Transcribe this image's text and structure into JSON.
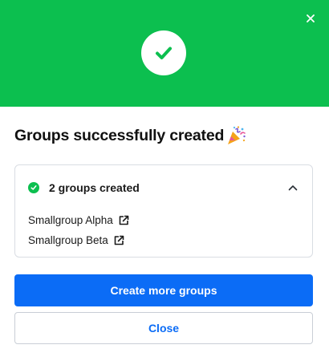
{
  "colors": {
    "banner": "#0cbf4f",
    "primary": "#0b6cf6",
    "border": "#d9dde3"
  },
  "icons": {
    "close": "close-icon",
    "success": "checkmark-icon",
    "celebration": "party-popper-icon",
    "collapse": "chevron-up-icon",
    "external": "external-link-icon"
  },
  "dialog": {
    "title": "Groups successfully created"
  },
  "summary": {
    "count_label": "2 groups created",
    "groups": [
      {
        "name": "Smallgroup Alpha"
      },
      {
        "name": "Smallgroup Beta"
      }
    ]
  },
  "actions": {
    "create_more": "Create more groups",
    "close": "Close"
  }
}
